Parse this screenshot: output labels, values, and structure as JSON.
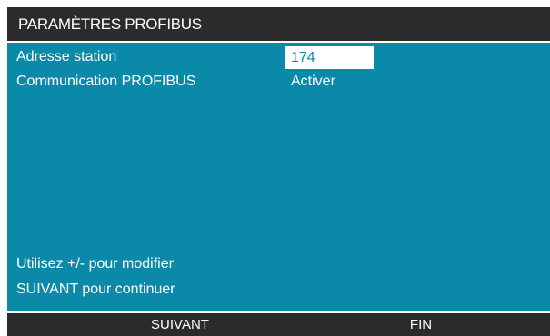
{
  "title": "PARAMÈTRES PROFIBUS",
  "fields": [
    {
      "label": "Adresse station",
      "value": "174",
      "selected": true
    },
    {
      "label": "Communication PROFIBUS",
      "value": "Activer",
      "selected": false
    }
  ],
  "hints": [
    "Utilisez +/- pour modifier",
    "SUIVANT pour continuer"
  ],
  "softkeys": {
    "left": "SUIVANT",
    "right": "FIN"
  },
  "colors": {
    "background": "#0a8aa8",
    "bar": "#2b2b2b",
    "text": "#ffffff"
  }
}
